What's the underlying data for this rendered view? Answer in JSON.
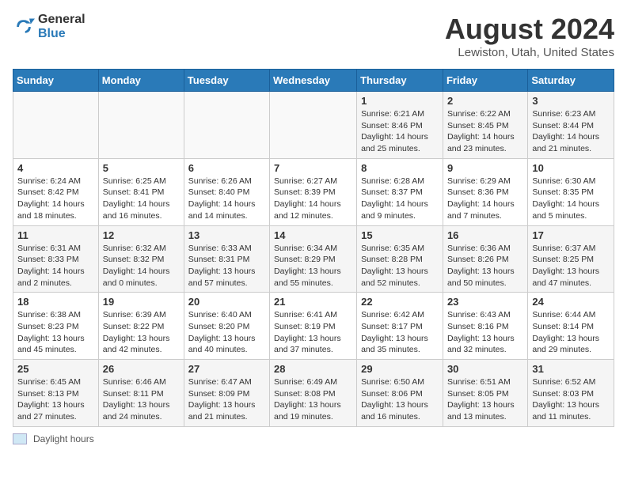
{
  "header": {
    "logo_general": "General",
    "logo_blue": "Blue",
    "month_title": "August 2024",
    "location": "Lewiston, Utah, United States"
  },
  "days_of_week": [
    "Sunday",
    "Monday",
    "Tuesday",
    "Wednesday",
    "Thursday",
    "Friday",
    "Saturday"
  ],
  "weeks": [
    [
      {
        "day": "",
        "info": ""
      },
      {
        "day": "",
        "info": ""
      },
      {
        "day": "",
        "info": ""
      },
      {
        "day": "",
        "info": ""
      },
      {
        "day": "1",
        "info": "Sunrise: 6:21 AM\nSunset: 8:46 PM\nDaylight: 14 hours\nand 25 minutes."
      },
      {
        "day": "2",
        "info": "Sunrise: 6:22 AM\nSunset: 8:45 PM\nDaylight: 14 hours\nand 23 minutes."
      },
      {
        "day": "3",
        "info": "Sunrise: 6:23 AM\nSunset: 8:44 PM\nDaylight: 14 hours\nand 21 minutes."
      }
    ],
    [
      {
        "day": "4",
        "info": "Sunrise: 6:24 AM\nSunset: 8:42 PM\nDaylight: 14 hours\nand 18 minutes."
      },
      {
        "day": "5",
        "info": "Sunrise: 6:25 AM\nSunset: 8:41 PM\nDaylight: 14 hours\nand 16 minutes."
      },
      {
        "day": "6",
        "info": "Sunrise: 6:26 AM\nSunset: 8:40 PM\nDaylight: 14 hours\nand 14 minutes."
      },
      {
        "day": "7",
        "info": "Sunrise: 6:27 AM\nSunset: 8:39 PM\nDaylight: 14 hours\nand 12 minutes."
      },
      {
        "day": "8",
        "info": "Sunrise: 6:28 AM\nSunset: 8:37 PM\nDaylight: 14 hours\nand 9 minutes."
      },
      {
        "day": "9",
        "info": "Sunrise: 6:29 AM\nSunset: 8:36 PM\nDaylight: 14 hours\nand 7 minutes."
      },
      {
        "day": "10",
        "info": "Sunrise: 6:30 AM\nSunset: 8:35 PM\nDaylight: 14 hours\nand 5 minutes."
      }
    ],
    [
      {
        "day": "11",
        "info": "Sunrise: 6:31 AM\nSunset: 8:33 PM\nDaylight: 14 hours\nand 2 minutes."
      },
      {
        "day": "12",
        "info": "Sunrise: 6:32 AM\nSunset: 8:32 PM\nDaylight: 14 hours\nand 0 minutes."
      },
      {
        "day": "13",
        "info": "Sunrise: 6:33 AM\nSunset: 8:31 PM\nDaylight: 13 hours\nand 57 minutes."
      },
      {
        "day": "14",
        "info": "Sunrise: 6:34 AM\nSunset: 8:29 PM\nDaylight: 13 hours\nand 55 minutes."
      },
      {
        "day": "15",
        "info": "Sunrise: 6:35 AM\nSunset: 8:28 PM\nDaylight: 13 hours\nand 52 minutes."
      },
      {
        "day": "16",
        "info": "Sunrise: 6:36 AM\nSunset: 8:26 PM\nDaylight: 13 hours\nand 50 minutes."
      },
      {
        "day": "17",
        "info": "Sunrise: 6:37 AM\nSunset: 8:25 PM\nDaylight: 13 hours\nand 47 minutes."
      }
    ],
    [
      {
        "day": "18",
        "info": "Sunrise: 6:38 AM\nSunset: 8:23 PM\nDaylight: 13 hours\nand 45 minutes."
      },
      {
        "day": "19",
        "info": "Sunrise: 6:39 AM\nSunset: 8:22 PM\nDaylight: 13 hours\nand 42 minutes."
      },
      {
        "day": "20",
        "info": "Sunrise: 6:40 AM\nSunset: 8:20 PM\nDaylight: 13 hours\nand 40 minutes."
      },
      {
        "day": "21",
        "info": "Sunrise: 6:41 AM\nSunset: 8:19 PM\nDaylight: 13 hours\nand 37 minutes."
      },
      {
        "day": "22",
        "info": "Sunrise: 6:42 AM\nSunset: 8:17 PM\nDaylight: 13 hours\nand 35 minutes."
      },
      {
        "day": "23",
        "info": "Sunrise: 6:43 AM\nSunset: 8:16 PM\nDaylight: 13 hours\nand 32 minutes."
      },
      {
        "day": "24",
        "info": "Sunrise: 6:44 AM\nSunset: 8:14 PM\nDaylight: 13 hours\nand 29 minutes."
      }
    ],
    [
      {
        "day": "25",
        "info": "Sunrise: 6:45 AM\nSunset: 8:13 PM\nDaylight: 13 hours\nand 27 minutes."
      },
      {
        "day": "26",
        "info": "Sunrise: 6:46 AM\nSunset: 8:11 PM\nDaylight: 13 hours\nand 24 minutes."
      },
      {
        "day": "27",
        "info": "Sunrise: 6:47 AM\nSunset: 8:09 PM\nDaylight: 13 hours\nand 21 minutes."
      },
      {
        "day": "28",
        "info": "Sunrise: 6:49 AM\nSunset: 8:08 PM\nDaylight: 13 hours\nand 19 minutes."
      },
      {
        "day": "29",
        "info": "Sunrise: 6:50 AM\nSunset: 8:06 PM\nDaylight: 13 hours\nand 16 minutes."
      },
      {
        "day": "30",
        "info": "Sunrise: 6:51 AM\nSunset: 8:05 PM\nDaylight: 13 hours\nand 13 minutes."
      },
      {
        "day": "31",
        "info": "Sunrise: 6:52 AM\nSunset: 8:03 PM\nDaylight: 13 hours\nand 11 minutes."
      }
    ]
  ],
  "footer": {
    "legend_label": "Daylight hours"
  }
}
